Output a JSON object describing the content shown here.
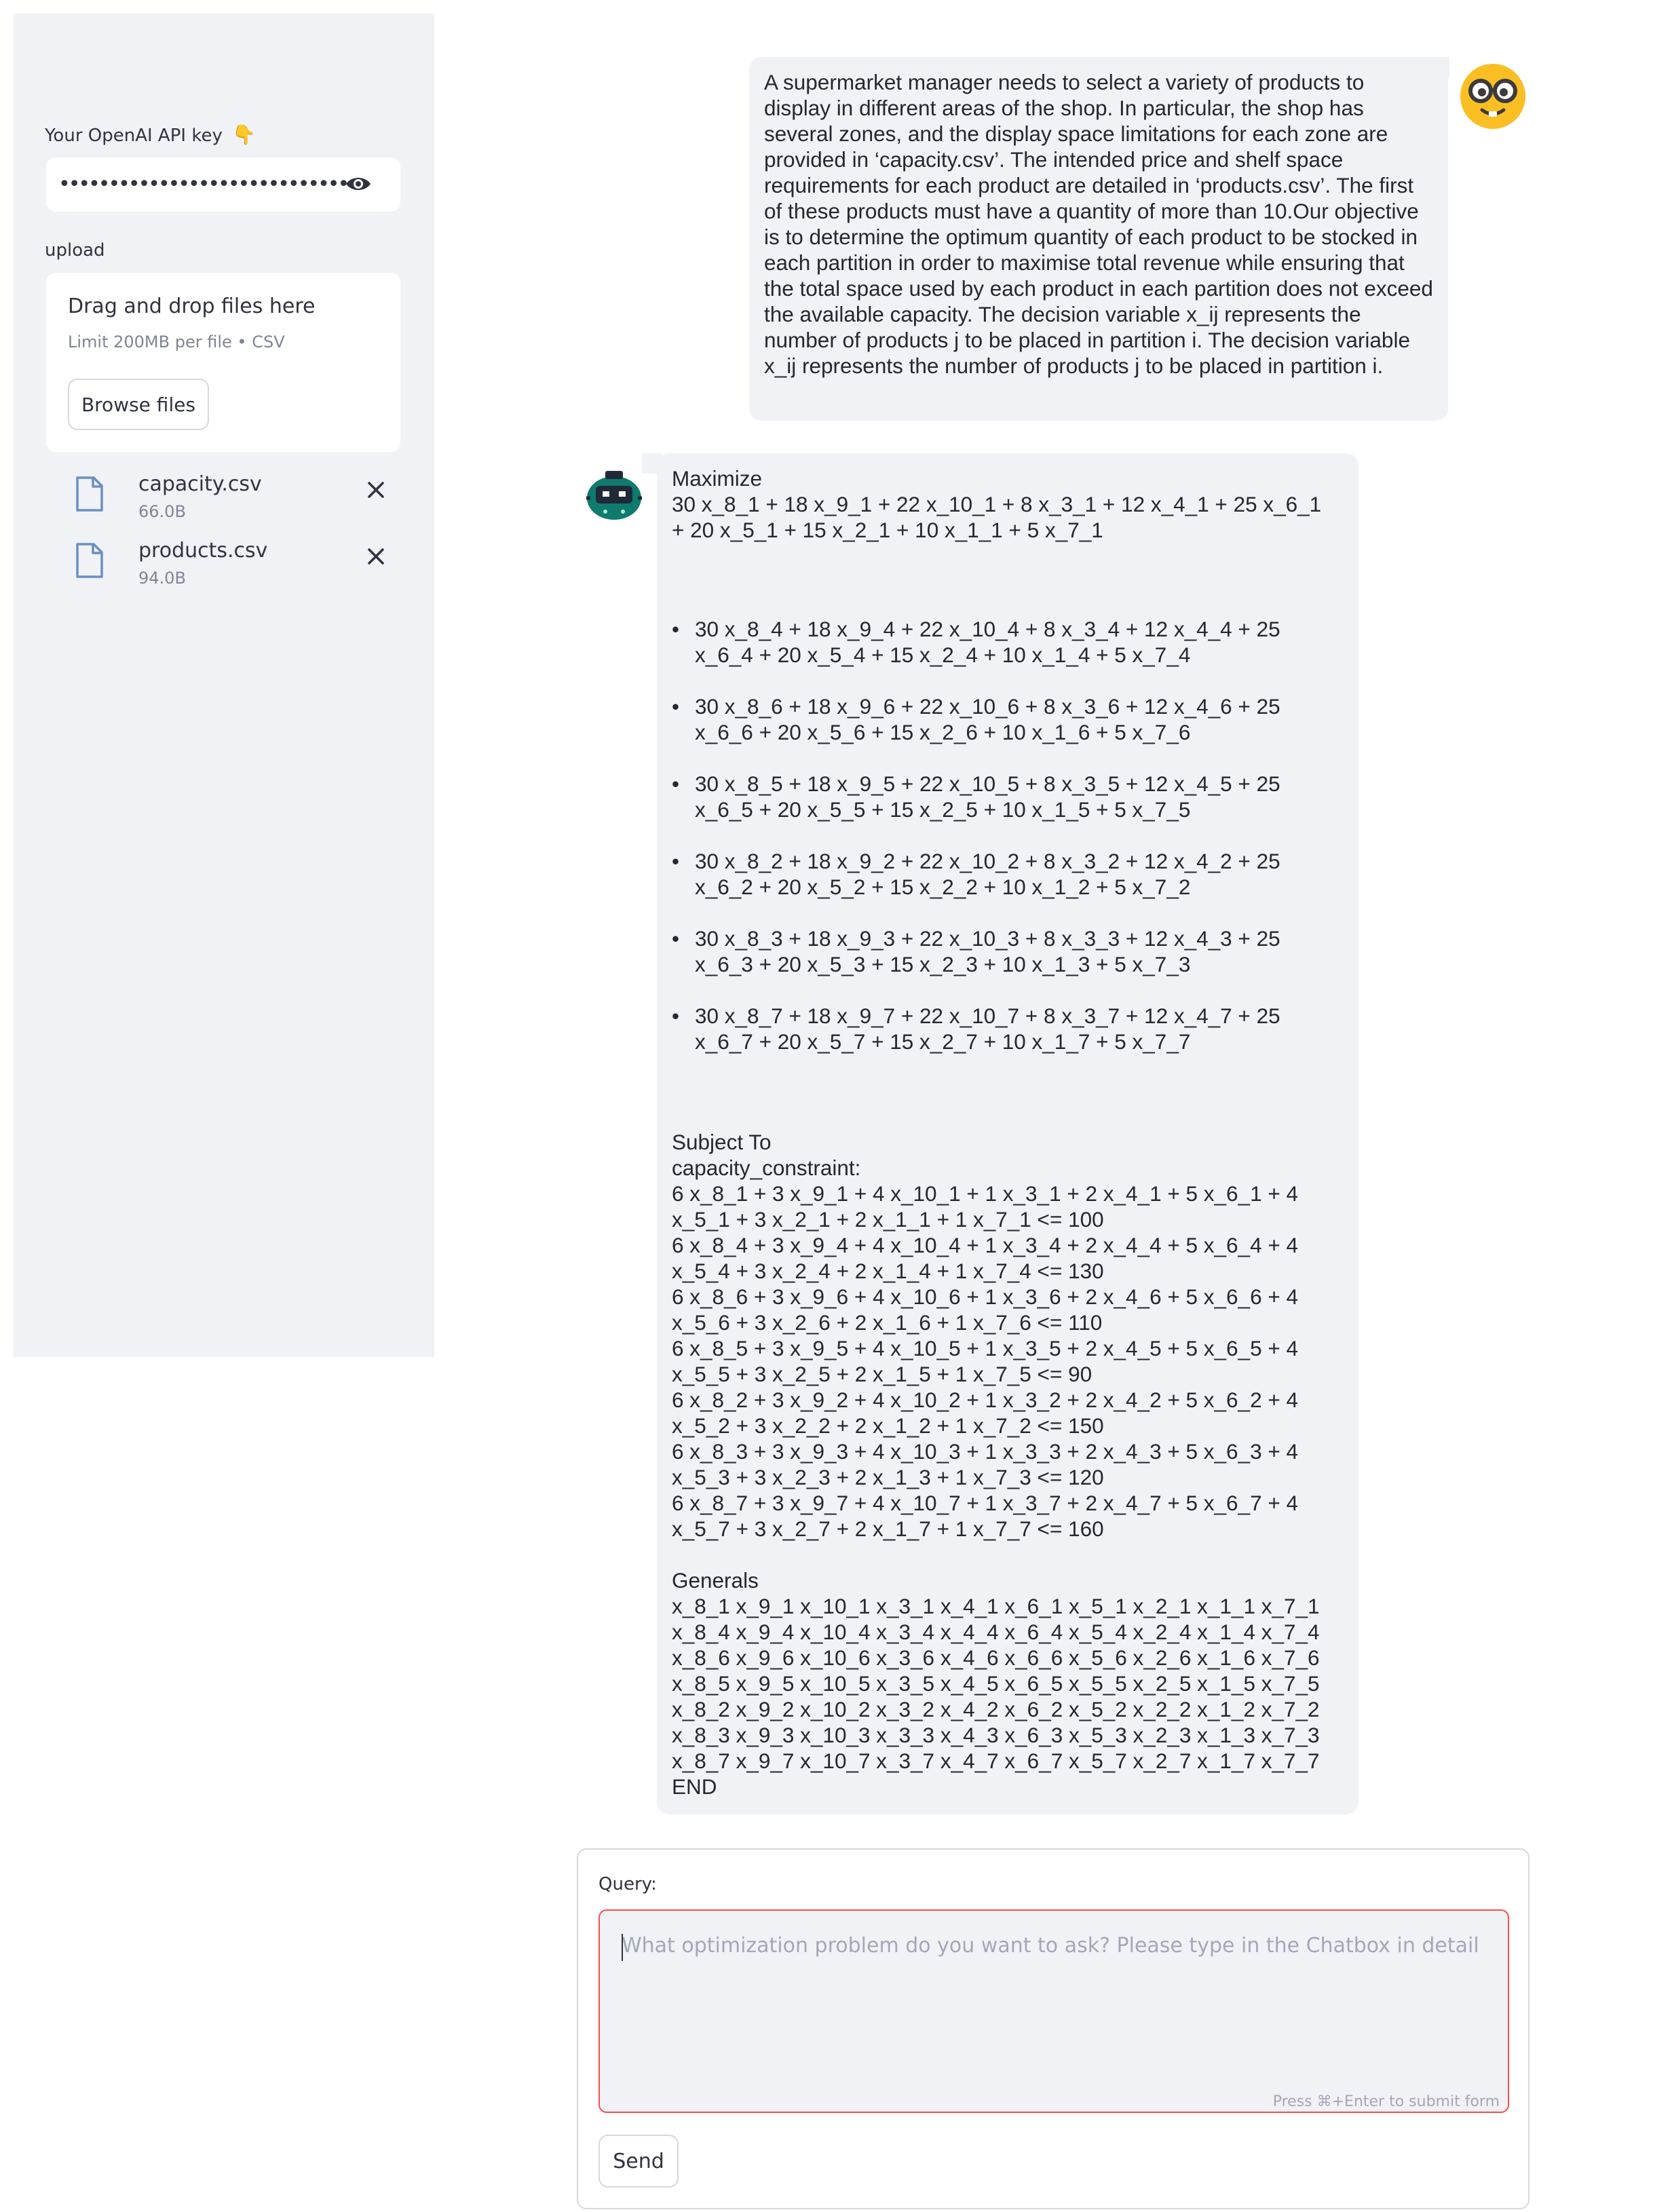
{
  "sidebar": {
    "api_key_label": "Your OpenAI API key",
    "api_key_icon": "pointing-down-hand-emoji",
    "api_key_masked": "••••••••••••••••••••••••••••••••••••••••••••••••••",
    "upload_label": "upload",
    "dropzone_title": "Drag and drop files here",
    "dropzone_limit": "Limit 200MB per file • CSV",
    "browse_button": "Browse files",
    "files": [
      {
        "name": "capacity.csv",
        "size": "66.0B"
      },
      {
        "name": "products.csv",
        "size": "94.0B"
      }
    ]
  },
  "chat": {
    "user_message": "A supermarket manager needs to select a variety of products to display in different areas of the shop. In particular, the shop has several zones, and the display space limitations for each zone are provided in ‘capacity.csv’. The intended price and shelf space requirements for each product are detailed in ‘products.csv’. The first of these products must have a quantity of more than 10.Our objective is to determine the optimum quantity of each product to be stocked in each partition in order to maximise total revenue while ensuring that the total space used by each product in each partition does not exceed the available capacity. The decision variable x_ij represents the number of products j to be placed in partition i. The decision variable x_ij represents the number of products j to be placed in partition i.",
    "bot": {
      "maximize_label": "Maximize",
      "objective_lines": [
        "30 x_8_1 + 18 x_9_1 + 22 x_10_1 + 8 x_3_1 + 12 x_4_1 + 25 x_6_1",
        "+ 20 x_5_1 + 15 x_2_1 + 10 x_1_1 + 5 x_7_1"
      ],
      "bullets": [
        [
          "30 x_8_4 + 18 x_9_4 + 22 x_10_4 + 8 x_3_4 + 12 x_4_4 + 25",
          "x_6_4 + 20 x_5_4 + 15 x_2_4 + 10 x_1_4 + 5 x_7_4"
        ],
        [
          "30 x_8_6 + 18 x_9_6 + 22 x_10_6 + 8 x_3_6 + 12 x_4_6 + 25",
          "x_6_6 + 20 x_5_6 + 15 x_2_6 + 10 x_1_6 + 5 x_7_6"
        ],
        [
          "30 x_8_5 + 18 x_9_5 + 22 x_10_5 + 8 x_3_5 + 12 x_4_5 + 25",
          "x_6_5 + 20 x_5_5 + 15 x_2_5 + 10 x_1_5 + 5 x_7_5"
        ],
        [
          "30 x_8_2 + 18 x_9_2 + 22 x_10_2 + 8 x_3_2 + 12 x_4_2 + 25",
          "x_6_2 + 20 x_5_2 + 15 x_2_2 + 10 x_1_2 + 5 x_7_2"
        ],
        [
          "30 x_8_3 + 18 x_9_3 + 22 x_10_3 + 8 x_3_3 + 12 x_4_3 + 25",
          "x_6_3 + 20 x_5_3 + 15 x_2_3 + 10 x_1_3 + 5 x_7_3"
        ],
        [
          "30 x_8_7 + 18 x_9_7 + 22 x_10_7 + 8 x_3_7 + 12 x_4_7 + 25",
          "x_6_7 + 20 x_5_7 + 15 x_2_7 + 10 x_1_7 + 5 x_7_7"
        ]
      ],
      "subject_to_label": "Subject To",
      "constraint_name": "capacity_constraint:",
      "constraint_lines": [
        "6 x_8_1 + 3 x_9_1 + 4 x_10_1 + 1 x_3_1 + 2 x_4_1 + 5 x_6_1 + 4",
        "x_5_1 + 3 x_2_1 + 2 x_1_1 + 1 x_7_1 <= 100",
        "6 x_8_4 + 3 x_9_4 + 4 x_10_4 + 1 x_3_4 + 2 x_4_4 + 5 x_6_4 + 4",
        "x_5_4 + 3 x_2_4 + 2 x_1_4 + 1 x_7_4 <= 130",
        "6 x_8_6 + 3 x_9_6 + 4 x_10_6 + 1 x_3_6 + 2 x_4_6 + 5 x_6_6 + 4",
        "x_5_6 + 3 x_2_6 + 2 x_1_6 + 1 x_7_6 <= 110",
        "6 x_8_5 + 3 x_9_5 + 4 x_10_5 + 1 x_3_5 + 2 x_4_5 + 5 x_6_5 + 4",
        "x_5_5 + 3 x_2_5 + 2 x_1_5 + 1 x_7_5 <= 90",
        "6 x_8_2 + 3 x_9_2 + 4 x_10_2 + 1 x_3_2 + 2 x_4_2 + 5 x_6_2 + 4",
        "x_5_2 + 3 x_2_2 + 2 x_1_2 + 1 x_7_2 <= 150",
        "6 x_8_3 + 3 x_9_3 + 4 x_10_3 + 1 x_3_3 + 2 x_4_3 + 5 x_6_3 + 4",
        "x_5_3 + 3 x_2_3 + 2 x_1_3 + 1 x_7_3 <= 120",
        "6 x_8_7 + 3 x_9_7 + 4 x_10_7 + 1 x_3_7 + 2 x_4_7 + 5 x_6_7 + 4",
        "x_5_7 + 3 x_2_7 + 2 x_1_7 + 1 x_7_7 <= 160"
      ],
      "generals_label": "Generals",
      "generals_lines": [
        "x_8_1 x_9_1 x_10_1 x_3_1 x_4_1 x_6_1 x_5_1 x_2_1 x_1_1 x_7_1",
        "x_8_4 x_9_4 x_10_4 x_3_4 x_4_4 x_6_4 x_5_4 x_2_4 x_1_4 x_7_4",
        "x_8_6 x_9_6 x_10_6 x_3_6 x_4_6 x_6_6 x_5_6 x_2_6 x_1_6 x_7_6",
        "x_8_5 x_9_5 x_10_5 x_3_5 x_4_5 x_6_5 x_5_5 x_2_5 x_1_5 x_7_5",
        "x_8_2 x_9_2 x_10_2 x_3_2 x_4_2 x_6_2 x_5_2 x_2_2 x_1_2 x_7_2",
        "x_8_3 x_9_3 x_10_3 x_3_3 x_4_3 x_6_3 x_5_3 x_2_3 x_1_3 x_7_3",
        "x_8_7 x_9_7 x_10_7 x_3_7 x_4_7 x_6_7 x_5_7 x_2_7 x_1_7 x_7_7"
      ],
      "end_label": "END"
    }
  },
  "form": {
    "query_label": "Query:",
    "query_placeholder": "What optimization problem do you want to ask? Please type in the Chatbox in detail",
    "query_value": "",
    "hint": "Press ⌘+Enter to submit form",
    "send_button": "Send"
  },
  "colors": {
    "sidebar_bg": "#f0f2f6",
    "bubble_bg": "#f0f2f6",
    "focus_border": "#ff4b4b",
    "user_avatar": "#fbbf24",
    "bot_avatar": "#0f7a6e"
  }
}
